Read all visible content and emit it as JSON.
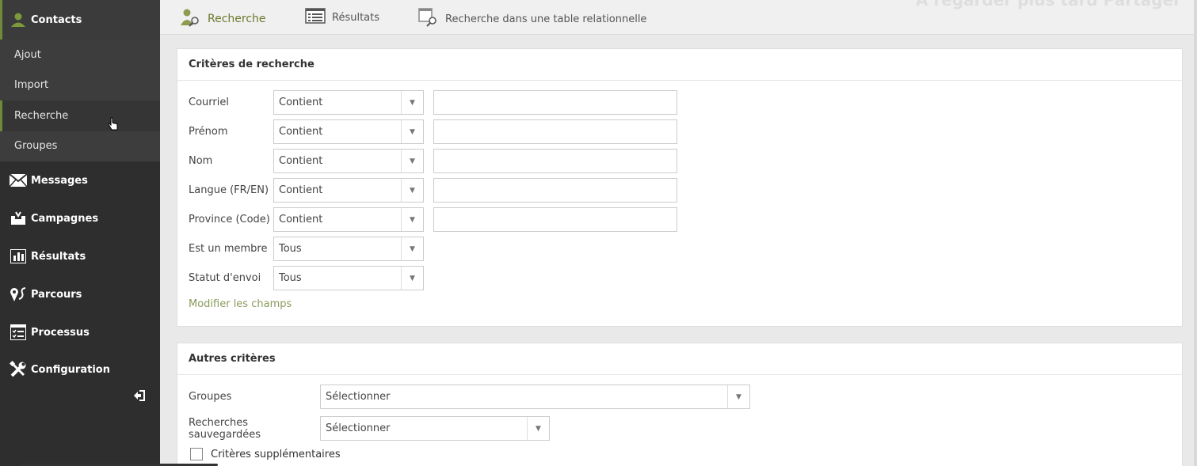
{
  "sidebar": {
    "contacts_label": "Contacts",
    "sub_items": [
      {
        "label": "Ajout"
      },
      {
        "label": "Import"
      },
      {
        "label": "Recherche"
      },
      {
        "label": "Groupes"
      }
    ],
    "items": [
      {
        "label": "Messages",
        "icon": "envelope-icon"
      },
      {
        "label": "Campagnes",
        "icon": "inbox-icon"
      },
      {
        "label": "Résultats",
        "icon": "bar-chart-icon"
      },
      {
        "label": "Parcours",
        "icon": "route-icon"
      },
      {
        "label": "Processus",
        "icon": "checklist-icon"
      },
      {
        "label": "Configuration",
        "icon": "tools-icon"
      }
    ],
    "collapse_icon": "collapse-icon"
  },
  "tabs": {
    "search": "Recherche",
    "results": "Résultats",
    "relational": "Recherche dans une table relationnelle"
  },
  "watermark": "À regarder plus tard   Partager",
  "criteria": {
    "title": "Critères de recherche",
    "rows": [
      {
        "label": "Courriel",
        "operator": "Contient",
        "value": ""
      },
      {
        "label": "Prénom",
        "operator": "Contient",
        "value": ""
      },
      {
        "label": "Nom",
        "operator": "Contient",
        "value": ""
      },
      {
        "label": "Langue (FR/EN)",
        "operator": "Contient",
        "value": ""
      },
      {
        "label": "Province (Code)",
        "operator": "Contient",
        "value": ""
      },
      {
        "label": "Est un membre",
        "operator": "Tous"
      },
      {
        "label": "Statut d'envoi",
        "operator": "Tous"
      }
    ],
    "modify_link": "Modifier les champs"
  },
  "other": {
    "title": "Autres critères",
    "groups_label": "Groupes",
    "groups_value": "Sélectionner",
    "saved_label": "Recherches sauvegardées",
    "saved_value": "Sélectionner",
    "extra_label": "Critères supplémentaires"
  },
  "colors": {
    "accent": "#6b7a2f",
    "sidebar_bg": "#2e2e2e"
  }
}
